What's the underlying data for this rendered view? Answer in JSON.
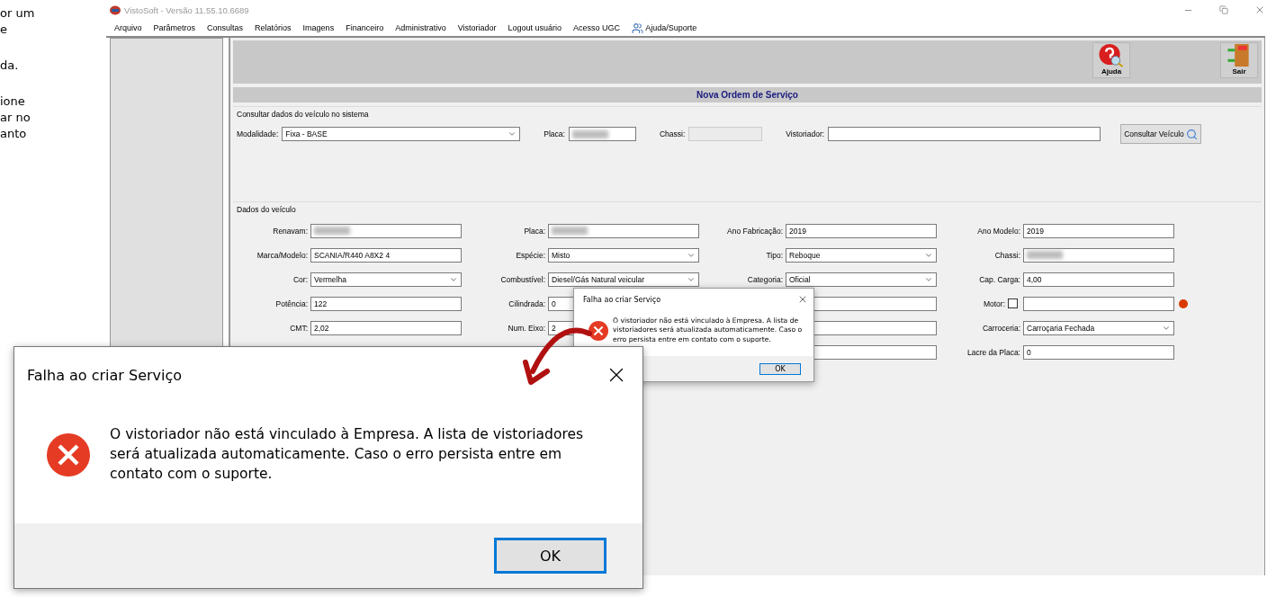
{
  "doc_text": [
    {
      "text": "or um",
      "kind": "top"
    },
    {
      "text": "e",
      "kind": "top"
    },
    {
      "text": "da.",
      "kind": "para"
    },
    {
      "text": "ione",
      "kind": "para"
    },
    {
      "text": "ar no",
      "kind": "line"
    },
    {
      "text": "anto",
      "kind": "line"
    }
  ],
  "window": {
    "title": "VistoSoft - Versão 11.55.10.6689"
  },
  "menu": [
    {
      "label": "Arquivo",
      "kind": "text"
    },
    {
      "label": "Parâmetros",
      "kind": "text"
    },
    {
      "label": "Consultas",
      "kind": "text"
    },
    {
      "label": "Relatórios",
      "kind": "text"
    },
    {
      "label": "Imagens",
      "kind": "text"
    },
    {
      "label": "Financeiro",
      "kind": "text"
    },
    {
      "label": "Administrativo",
      "kind": "text"
    },
    {
      "label": "Vistoriador",
      "kind": "text"
    },
    {
      "label": "Logout usuário",
      "kind": "text"
    },
    {
      "label": "Acesso UGC",
      "kind": "text"
    },
    {
      "label": "Ajuda/Suporte",
      "kind": "icon"
    }
  ],
  "toolbar": [
    {
      "label": "Ajuda",
      "kind": "help"
    },
    {
      "label": "Sair",
      "kind": "exit"
    }
  ],
  "form_title": "Nova Ordem de Serviço",
  "consult": {
    "legend": "Consultar dados do veículo no sistema",
    "fields": [
      {
        "label": "Modalidade:",
        "kind": "select",
        "value": "Fixa - BASE"
      },
      {
        "label": "Placa:",
        "kind": "text",
        "redacted": true
      },
      {
        "label": "Chassi:",
        "kind": "disabled"
      },
      {
        "label": "Vistoriador:",
        "kind": "text"
      }
    ],
    "button": "Consultar Veículo"
  },
  "vehicle": {
    "legend": "Dados do veículo",
    "rows": [
      [
        {
          "label": "Renavam:",
          "kind": "text",
          "redacted": true
        },
        {
          "label": "Placa:",
          "kind": "text",
          "redacted": true
        },
        {
          "label": "Ano Fabricação:",
          "kind": "text",
          "value": "2019"
        },
        {
          "label": "Ano Modelo:",
          "kind": "text",
          "value": "2019"
        }
      ],
      [
        {
          "label": "Marca/Modelo:",
          "kind": "text",
          "value": "SCANIA/R440 A8X2 4"
        },
        {
          "label": "Espécie:",
          "kind": "select",
          "value": "Misto"
        },
        {
          "label": "Tipo:",
          "kind": "select",
          "value": "Reboque"
        },
        {
          "label": "Chassi:",
          "kind": "text",
          "redacted": true
        }
      ],
      [
        {
          "label": "Cor:",
          "kind": "select",
          "value": "Vermelha"
        },
        {
          "label": "Combustível:",
          "kind": "select",
          "value": "Diesel/Gás Natural veicular"
        },
        {
          "label": "Categoria:",
          "kind": "select",
          "value": "Oficial"
        },
        {
          "label": "Cap. Carga:",
          "kind": "text",
          "value": "4,00"
        }
      ],
      [
        {
          "label": "Potência:",
          "kind": "text",
          "value": "122"
        },
        {
          "label": "Cilindrada:",
          "kind": "text",
          "value": "0"
        },
        {
          "kind": "text"
        },
        {
          "label": "Motor:",
          "kind": "text",
          "checked": false,
          "warning": true
        }
      ],
      [
        {
          "label": "CMT:",
          "kind": "text",
          "value": "2,02"
        },
        {
          "label": "Num. Eixo:",
          "kind": "text",
          "value": "2"
        },
        {
          "kind": "text"
        },
        {
          "label": "Carroceria:",
          "kind": "select",
          "value": "Carroçaria Fechada"
        }
      ],
      [
        {
          "kind": "covered"
        },
        {
          "kind": "covered"
        },
        {
          "kind": "text"
        },
        {
          "label": "Lacre da Placa:",
          "kind": "text",
          "value": "0"
        }
      ]
    ]
  },
  "dialog_small": {
    "title": "Falha ao criar Serviço",
    "message": "O vistoriador não está vinculado à Empresa.  A lista de vistoriadores será atualizada automaticamente. Caso o erro persista entre em contato com o suporte.",
    "button": "OK"
  },
  "dialog_zoomed": {
    "title": "Falha ao criar Serviço",
    "message": "O vistoriador não está vinculado à Empresa.  A lista de vistoriadores será atualizada automaticamente. Caso o erro persista entre em contato com o suporte.",
    "button": "OK"
  }
}
